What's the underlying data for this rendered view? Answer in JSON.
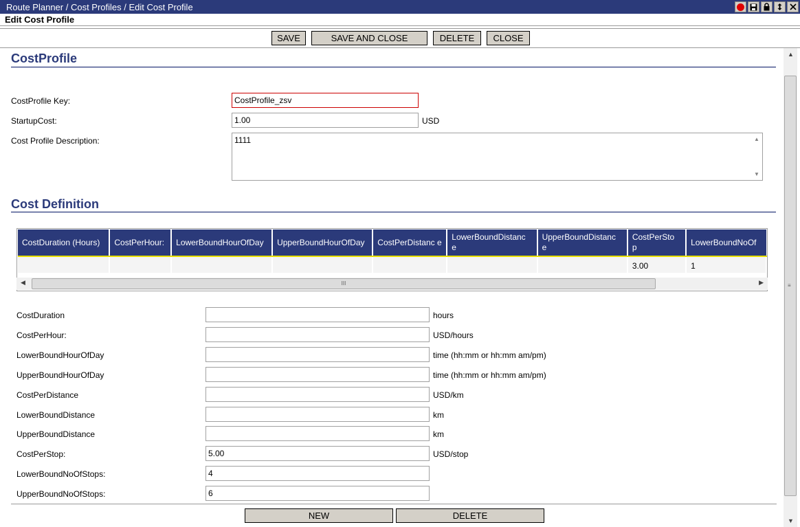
{
  "window": {
    "breadcrumb": "Route Planner / Cost Profiles / Edit Cost Profile",
    "subtitle": "Edit Cost Profile"
  },
  "toolbar": {
    "save": "SAVE",
    "save_and_close": "SAVE AND CLOSE",
    "delete": "DELETE",
    "close": "CLOSE"
  },
  "cost_profile": {
    "section_title": "CostProfile",
    "key_label": "CostProfile Key:",
    "key_value": "CostProfile_zsv",
    "startup_label": "StartupCost:",
    "startup_value": "1.00",
    "startup_unit": "USD",
    "desc_label": "Cost Profile Description:",
    "desc_value": "1111"
  },
  "cost_definition": {
    "section_title": "Cost Definition",
    "columns": [
      "CostDuration (Hours)",
      "CostPerHour:",
      "LowerBoundHourOfDay",
      "UpperBoundHourOfDay",
      "CostPerDistanc e",
      "LowerBoundDistanc e",
      "UpperBoundDistanc e",
      "CostPerSto p",
      "LowerBoundNoOf"
    ],
    "rows": [
      [
        "",
        "",
        "",
        "",
        "",
        "",
        "",
        "3.00",
        "1"
      ]
    ],
    "scroll_grip": "III"
  },
  "form": {
    "fields": [
      {
        "label": "CostDuration",
        "value": "",
        "unit": "hours"
      },
      {
        "label": "CostPerHour:",
        "value": "",
        "unit": "USD/hours"
      },
      {
        "label": "LowerBoundHourOfDay",
        "value": "",
        "unit": "time (hh:mm or hh:mm am/pm)"
      },
      {
        "label": "UpperBoundHourOfDay",
        "value": "",
        "unit": "time (hh:mm or hh:mm am/pm)"
      },
      {
        "label": "CostPerDistance",
        "value": "",
        "unit": "USD/km"
      },
      {
        "label": "LowerBoundDistance",
        "value": "",
        "unit": "km"
      },
      {
        "label": "UpperBoundDistance",
        "value": "",
        "unit": "km"
      },
      {
        "label": "CostPerStop:",
        "value": "5.00",
        "unit": "USD/stop"
      },
      {
        "label": "LowerBoundNoOfStops:",
        "value": "4",
        "unit": ""
      },
      {
        "label": "UpperBoundNoOfStops:",
        "value": "6",
        "unit": ""
      }
    ],
    "new_button": "NEW",
    "delete_button": "DELETE"
  },
  "colors": {
    "title_bar": "#2b3a7a",
    "section_title": "#2b3a7a",
    "grid_header": "#2b3a7a",
    "button_face": "#d4d0c8",
    "error_border": "#cc0000"
  },
  "icons": [
    "record-icon",
    "save-icon",
    "lock-icon",
    "refresh-icon",
    "close-icon"
  ]
}
